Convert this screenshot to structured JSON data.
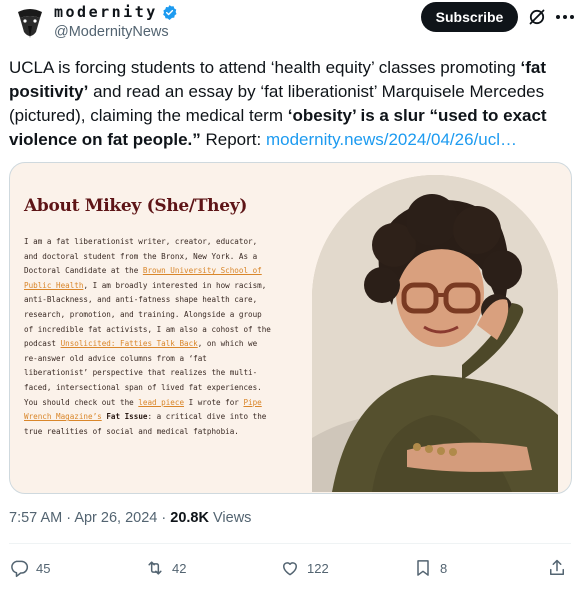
{
  "account": {
    "display_name": "modernity",
    "handle": "@ModernityNews",
    "verified": true
  },
  "header": {
    "subscribe_label": "Subscribe",
    "icons": [
      "avatar-crow-logo",
      "verified-badge-icon",
      "grok-icon",
      "more-icon"
    ]
  },
  "tweet": {
    "segments": [
      {
        "text": "UCLA is forcing students to attend ‘health equity’ classes promoting ",
        "style": "normal"
      },
      {
        "text": "‘fat positivity’",
        "style": "bold"
      },
      {
        "text": " and read an essay by ‘fat liberationist’ Marquisele Mercedes (pictured), claiming the medical term ",
        "style": "normal"
      },
      {
        "text": "‘obesity’ is a slur “used to exact violence on fat people.”",
        "style": "bold"
      },
      {
        "text": " Report: ",
        "style": "normal"
      },
      {
        "text": "modernity.news/2024/04/26/ucl…",
        "style": "link"
      }
    ]
  },
  "media": {
    "title": "About Mikey (She/They)",
    "body_segments": [
      {
        "text": "I am a fat liberationist writer, creator, educator, and doctoral student from the Bronx, New York. As a Doctoral Candidate at the ",
        "style": "normal"
      },
      {
        "text": "Brown University School of Public Health",
        "style": "link"
      },
      {
        "text": ", I am broadly interested in how racism, anti-Blackness, and anti-fatness shape health care, research, promotion, and training. Alongside a group of incredible fat activists, I am also a cohost of the podcast ",
        "style": "normal"
      },
      {
        "text": "Unsolicited: Fatties Talk Back",
        "style": "link"
      },
      {
        "text": ", on which we re-answer old advice columns from a ‘fat liberationist’ perspective that realizes the multi-faced, intersectional span of lived fat experiences. You should check out the ",
        "style": "normal"
      },
      {
        "text": "lead piece",
        "style": "link"
      },
      {
        "text": " I wrote for ",
        "style": "normal"
      },
      {
        "text": "Pipe Wrench Magazine’s",
        "style": "link"
      },
      {
        "text": " ",
        "style": "normal"
      },
      {
        "text": "Fat Issue",
        "style": "bold"
      },
      {
        "text": ": a critical dive into the true realities of social and medical fatphobia.",
        "style": "normal"
      }
    ]
  },
  "meta": {
    "time": "7:57 AM",
    "separator": "·",
    "date": "Apr 26, 2024",
    "views_count": "20.8K",
    "views_label": "Views"
  },
  "actions": {
    "replies": "45",
    "reposts": "42",
    "likes": "122",
    "bookmarks": "8"
  },
  "colors": {
    "text": "#0f1419",
    "secondary": "#536471",
    "link": "#1d9bf0",
    "verified": "#1d9bf0",
    "media_bg": "#fbf2ea",
    "media_title": "#5e1517",
    "media_link": "#d9862a"
  }
}
